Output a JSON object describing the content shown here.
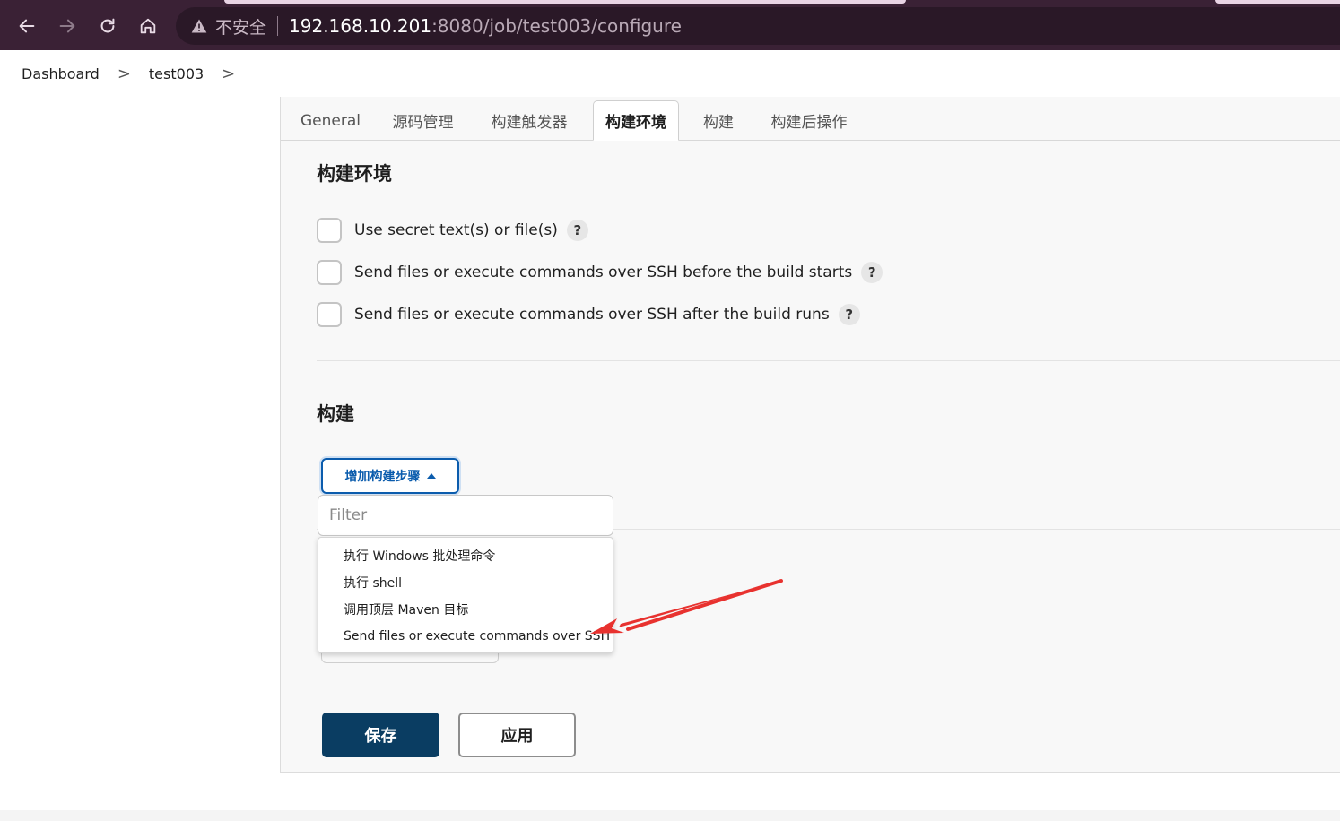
{
  "browser": {
    "insecure_label": "不安全",
    "url_host": "192.168.10.201",
    "url_path": ":8080/job/test003/configure",
    "icons": [
      "back-arrow-icon",
      "forward-arrow-icon",
      "reload-icon",
      "home-icon",
      "warning-triangle-icon"
    ]
  },
  "breadcrumb": {
    "items": [
      "Dashboard",
      "test003"
    ],
    "separator": ">"
  },
  "tabs": [
    {
      "label": "General",
      "active": false
    },
    {
      "label": "源码管理",
      "active": false
    },
    {
      "label": "构建触发器",
      "active": false
    },
    {
      "label": "构建环境",
      "active": true
    },
    {
      "label": "构建",
      "active": false
    },
    {
      "label": "构建后操作",
      "active": false
    }
  ],
  "build_env": {
    "title": "构建环境",
    "options": [
      {
        "label": "Use secret text(s) or file(s)",
        "checked": false,
        "help": "?"
      },
      {
        "label": "Send files or execute commands over SSH before the build starts",
        "checked": false,
        "help": "?"
      },
      {
        "label": "Send files or execute commands over SSH after the build runs",
        "checked": false,
        "help": "?"
      }
    ]
  },
  "build": {
    "title": "构建",
    "add_step_label": "增加构建步骤",
    "filter_placeholder": "Filter",
    "menu_items": [
      "执行 Windows 批处理命令",
      "执行 shell",
      "调用顶层 Maven 目标",
      "Send files or execute commands over SSH"
    ]
  },
  "actions": {
    "save_label": "保存",
    "apply_label": "应用"
  },
  "colors": {
    "browser_bar": "#3a2135",
    "primary_button": "#0a3d62",
    "link_blue": "#0b5cad",
    "annotation_arrow": "#e8322f"
  }
}
